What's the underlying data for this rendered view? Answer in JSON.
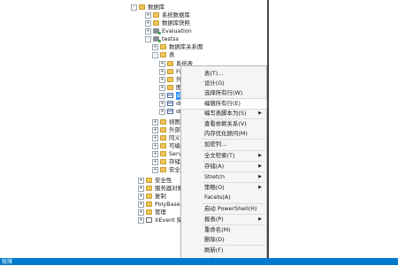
{
  "tree": {
    "items": [
      {
        "label": "数据库",
        "exp": "-",
        "icon": "folder-icon"
      },
      {
        "label": "系统数据库",
        "exp": "+",
        "icon": "folder-icon"
      },
      {
        "label": "数据库快照",
        "exp": "+",
        "icon": "folder-icon"
      },
      {
        "label": "Evaluation",
        "exp": "+",
        "icon": "database-icon"
      },
      {
        "label": "testss",
        "exp": "-",
        "icon": "database-icon"
      },
      {
        "label": "数据库关系图",
        "exp": "+",
        "icon": "folder-icon"
      },
      {
        "label": "表",
        "exp": "-",
        "icon": "folder-icon"
      },
      {
        "label": "系统表",
        "exp": "+",
        "icon": "folder-icon"
      },
      {
        "label": "FileTab",
        "exp": "+",
        "icon": "folder-icon"
      },
      {
        "label": "外部表",
        "exp": "+",
        "icon": "folder-icon"
      },
      {
        "label": "图形表",
        "exp": "+",
        "icon": "folder-icon"
      },
      {
        "label": "dbo.te",
        "exp": "+",
        "icon": "table-icon",
        "selected": true
      },
      {
        "label": "dbo.te",
        "exp": "+",
        "icon": "table-icon"
      },
      {
        "label": "dbo.te",
        "exp": "+",
        "icon": "table-icon"
      },
      {
        "label": "视图",
        "exp": "+",
        "icon": "folder-icon"
      },
      {
        "label": "外部资源",
        "exp": "+",
        "icon": "folder-icon"
      },
      {
        "label": "同义词",
        "exp": "+",
        "icon": "folder-icon"
      },
      {
        "label": "可编程性",
        "exp": "+",
        "icon": "folder-icon"
      },
      {
        "label": "Service Br",
        "exp": "+",
        "icon": "folder-icon"
      },
      {
        "label": "存储",
        "exp": "+",
        "icon": "folder-icon"
      },
      {
        "label": "安全性",
        "exp": "+",
        "icon": "folder-icon"
      },
      {
        "label": "安全性",
        "exp": "+",
        "icon": "folder-icon"
      },
      {
        "label": "服务器对象",
        "exp": "+",
        "icon": "folder-icon"
      },
      {
        "label": "复制",
        "exp": "+",
        "icon": "folder-icon"
      },
      {
        "label": "PolyBase",
        "exp": "+",
        "icon": "folder-icon"
      },
      {
        "label": "管理",
        "exp": "+",
        "icon": "folder-icon"
      },
      {
        "label": "XEvent 探查器",
        "exp": "+",
        "icon": "checkbox-icon"
      }
    ]
  },
  "menu": {
    "items": [
      {
        "label": "表(T)...",
        "sub": false
      },
      {
        "label": "设计(G)",
        "sub": false
      },
      {
        "label": "选择所有行(W)",
        "sub": false
      },
      {
        "label": "编辑所有行(E)",
        "sub": false,
        "highlight": true
      },
      {
        "label": "编写表脚本为(S)",
        "sub": true
      },
      {
        "sep": true
      },
      {
        "label": "查看依赖关系(V)",
        "sub": false
      },
      {
        "label": "内存优化顾问(M)",
        "sub": false
      },
      {
        "sep": true
      },
      {
        "label": "加密列...",
        "sub": false
      },
      {
        "sep": true
      },
      {
        "label": "全文检索(T)",
        "sub": true
      },
      {
        "sep": true
      },
      {
        "label": "存储(A)",
        "sub": true
      },
      {
        "sep": true
      },
      {
        "label": "Stretch",
        "sub": true
      },
      {
        "sep": true
      },
      {
        "label": "策略(O)",
        "sub": true
      },
      {
        "label": "Facets(A)",
        "sub": false
      },
      {
        "sep": true
      },
      {
        "label": "启动 PowerShell(H)",
        "sub": false
      },
      {
        "sep": true
      },
      {
        "label": "报表(P)",
        "sub": true
      },
      {
        "sep": true
      },
      {
        "label": "重命名(M)",
        "sub": false
      },
      {
        "label": "删除(D)",
        "sub": false
      },
      {
        "sep": true
      },
      {
        "label": "刷新(F)",
        "sub": false
      },
      {
        "label": "属性(R)",
        "sub": false
      }
    ]
  },
  "status": {
    "text": "就绪"
  },
  "colors": {
    "accent": "#007acc",
    "selection": "#3399ff"
  }
}
